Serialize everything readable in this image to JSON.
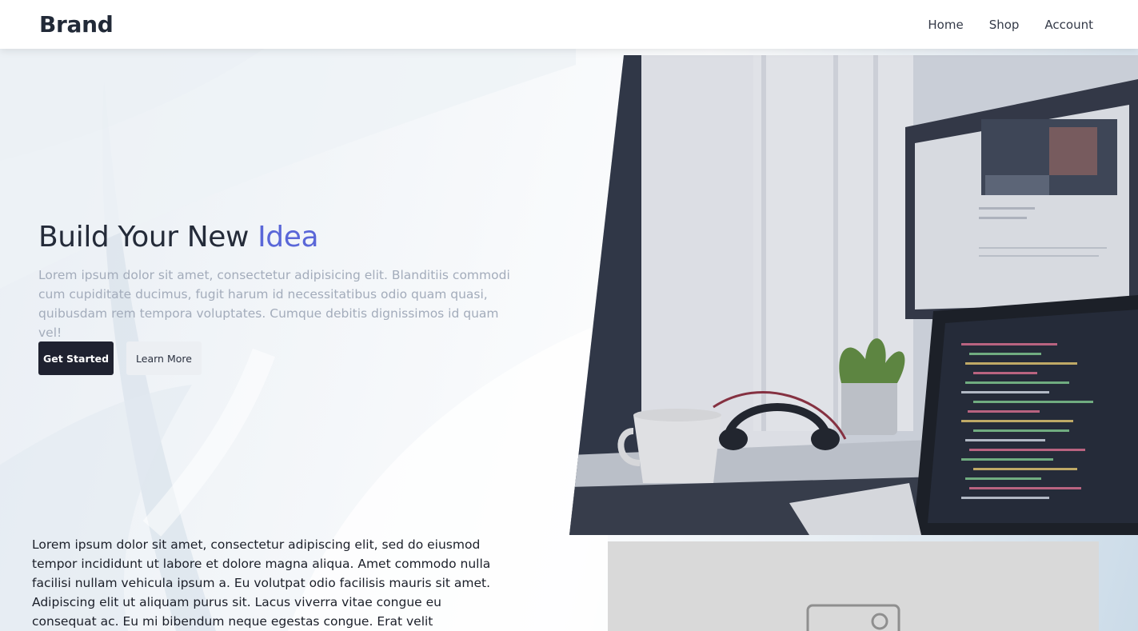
{
  "header": {
    "brand": "Brand",
    "nav": [
      {
        "label": "Home"
      },
      {
        "label": "Shop"
      },
      {
        "label": "Account"
      }
    ]
  },
  "hero": {
    "title_main": "Build Your New ",
    "title_accent": "Idea",
    "description": "Lorem ipsum dolor sit amet, consectetur adipisicing elit. Blanditiis commodi cum cupiditate ducimus, fugit harum id necessitatibus odio quam quasi, quibusdam rem tempora voluptates. Cumque debitis dignissimos id quam vel!",
    "primary_button": "Get Started",
    "secondary_button": "Learn More"
  },
  "content": {
    "paragraph": "Lorem ipsum dolor sit amet, consectetur adipiscing elit, sed do eiusmod tempor incididunt ut labore et dolore magna aliqua. Amet commodo nulla facilisi nullam vehicula ipsum a. Eu volutpat odio facilisis mauris sit amet. Adipiscing elit ut aliquam purus sit. Lacus viverra vitae congue eu consequat ac. Eu mi bibendum neque egestas congue. Erat velit scelerisque in dictum non. Varius vel pharetra"
  },
  "colors": {
    "accent": "#5a67d8",
    "primary_button_bg": "#1f2230",
    "heading": "#242b39",
    "muted_text": "#a3acbb"
  },
  "icons": {
    "placeholder": "image-placeholder-icon"
  }
}
